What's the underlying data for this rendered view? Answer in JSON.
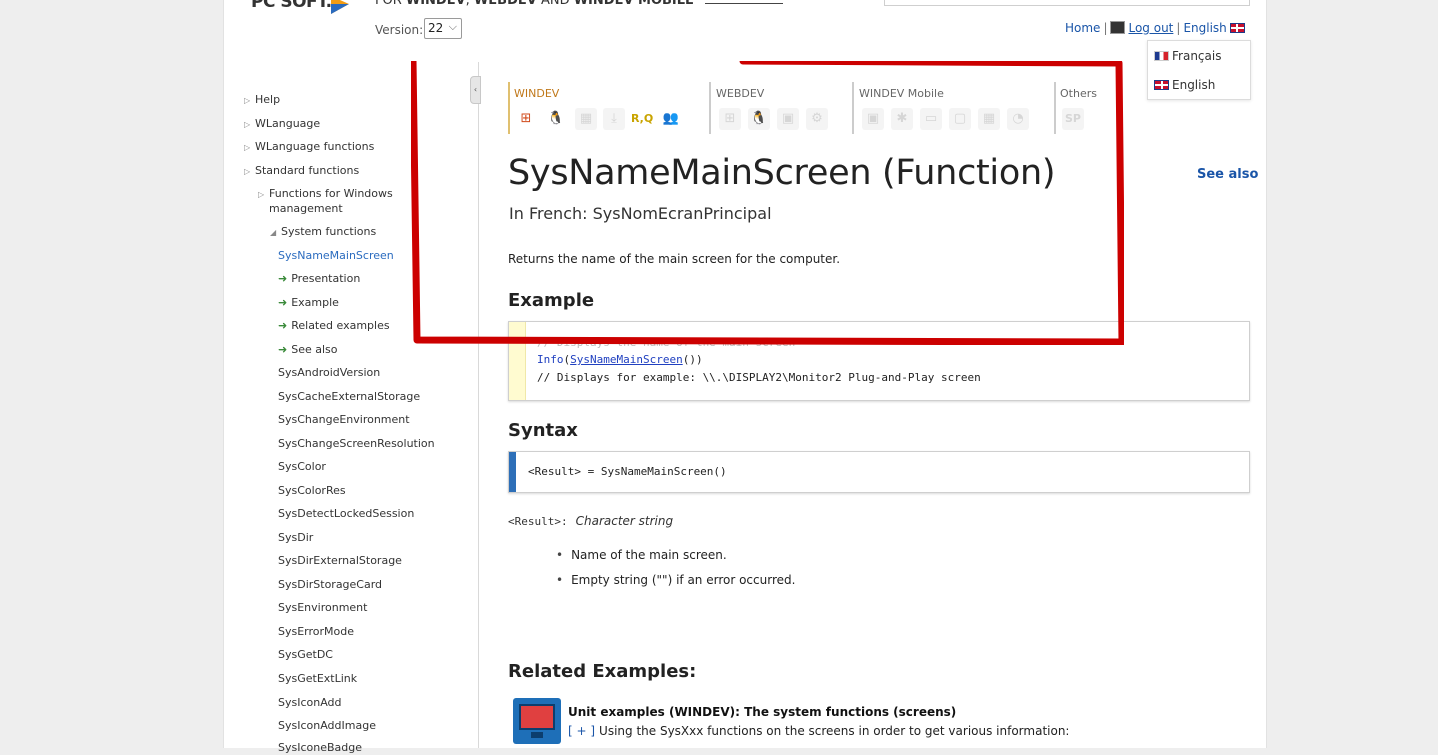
{
  "header": {
    "logo_text": "PC SOFT.",
    "title_prefix": "FOR ",
    "title_windev": "WINDEV",
    "title_sep1": ", ",
    "title_webdev": "WEBDEV",
    "title_and": " AND ",
    "title_mobile": "WINDEV MOBILE",
    "version_label": "Version:",
    "version_value": "22",
    "links": {
      "home": "Home",
      "logout": "Log out",
      "language": "English"
    }
  },
  "language_menu": [
    "Français",
    "English"
  ],
  "sidebar": {
    "collapse_glyph": "‹",
    "items": [
      "Help",
      "WLanguage",
      "WLanguage functions",
      "Standard functions",
      "Functions for Windows",
      "management",
      "System functions",
      "SysNameMainScreen",
      "Presentation",
      "Example",
      "Related examples",
      "See also",
      "SysAndroidVersion",
      "SysCacheExternalStorage",
      "SysChangeEnvironment",
      "SysChangeScreenResolution",
      "SysColor",
      "SysColorRes",
      "SysDetectLockedSession",
      "SysDir",
      "SysDirExternalStorage",
      "SysDirStorageCard",
      "SysEnvironment",
      "SysErrorMode",
      "SysGetDC",
      "SysGetExtLink",
      "SysIconAdd",
      "SysIconAddImage",
      "SysIconeBadge"
    ]
  },
  "platforms": {
    "labels": [
      "WINDEV",
      "WEBDEV",
      "WINDEV Mobile",
      "Others"
    ],
    "windev_icons": [
      "windows-icon",
      "linux-icon",
      "windows-gray-icon",
      "download-icon",
      "report-query-icon",
      "users-icon"
    ],
    "windev_glyphs": [
      "⊞",
      "🐧",
      "▦",
      "⤓",
      "R,Q",
      "👥"
    ],
    "webdev_glyphs": [
      "⊞",
      "🐧",
      "▣",
      "⚙"
    ],
    "mobile_glyphs": [
      "▣",
      "✱",
      "▭",
      "▢",
      "▦",
      "◔"
    ],
    "others_glyphs": [
      "SP"
    ]
  },
  "main": {
    "title": "SysNameMainScreen (Function)",
    "french_name": "In French: SysNomEcranPrincipal",
    "see_also": "See also",
    "description": "Returns the name of the main screen for the computer.",
    "example_heading": "Example",
    "example_code": {
      "line1_hidden": "// Displays the name of the main screen",
      "line2_fn": "Info",
      "line2_arg": "SysNameMainScreen",
      "line2_tail": "())",
      "line3": "// Displays for example: \\\\.\\DISPLAY2\\Monitor2 Plug-and-Play screen"
    },
    "syntax_heading": "Syntax",
    "syntax": "<Result> = SysNameMainScreen()",
    "result_name": "<Result>:",
    "result_type": "Character string",
    "result_bullets": [
      "Name of the main screen.",
      "Empty string (\"\") if an error occurred."
    ],
    "related_heading": "Related Examples:",
    "related_title": "Unit examples (WINDEV): The system functions (screens)",
    "related_plus": "[ + ]",
    "related_desc": "Using the SysXxx functions on the screens in order to get various information:"
  },
  "colors": {
    "highlight": "#cc0000",
    "link": "#1a55a8",
    "syntax_bar": "#2d6fb8",
    "example_bar": "#fffbd0"
  }
}
